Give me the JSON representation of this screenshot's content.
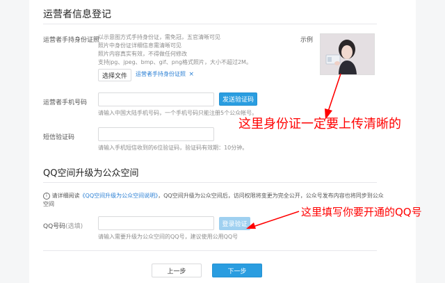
{
  "section1": {
    "title": "运营者信息登记",
    "id_photo": {
      "label": "运营者手持身份证照",
      "hints": [
        "以示意图方式手持身份证，需免冠，五官清晰可见",
        "照片中身份证详细信息需清晰可见",
        "照片内容真实有效，不得做任何修改",
        "支持jpg、jpeg、bmp、gif、png格式照片，大小不超过2M。"
      ],
      "choose_button": "选择文件",
      "file_name": "运营者手持身份证照",
      "example_label": "示例"
    },
    "phone": {
      "label": "运营者手机号码",
      "value": "",
      "placeholder": "",
      "send_button": "发送验证码",
      "hint": "请输入中国大陆手机号码，一个手机号码只能注册5个公众帐号。"
    },
    "sms": {
      "label": "短信验证码",
      "value": "",
      "placeholder": "",
      "hint": "请输入手机短信收到的6位验证码，验证码有效期：10分钟。"
    }
  },
  "section2": {
    "title": "QQ空间升级为公众空间",
    "notice_prefix": "请详细阅读",
    "notice_link": "《QQ空间升级为公众空间说明》",
    "notice_suffix": "，QQ空间升级为公众空间后，访问权限将变更为完全公开，公众号发布内容也将同步到公众",
    "notice_line2": "空间",
    "qq": {
      "label": "QQ号码",
      "label_optional": "(选填)",
      "value": "",
      "placeholder": "",
      "verify_button": "登录验证",
      "hint": "请输入需要升级为公众空间的QQ号，建议使用公用QQ号"
    }
  },
  "footer": {
    "prev_button": "上一步",
    "next_button": "下一步"
  },
  "annotations": {
    "id_note": "这里身份证一定要上传清晰的",
    "qq_note": "这里填写你要开通的QQ号"
  },
  "colors": {
    "accent_blue": "#2a9de0",
    "link_blue": "#2a7fd4",
    "annotation_red": "#ff0000"
  }
}
